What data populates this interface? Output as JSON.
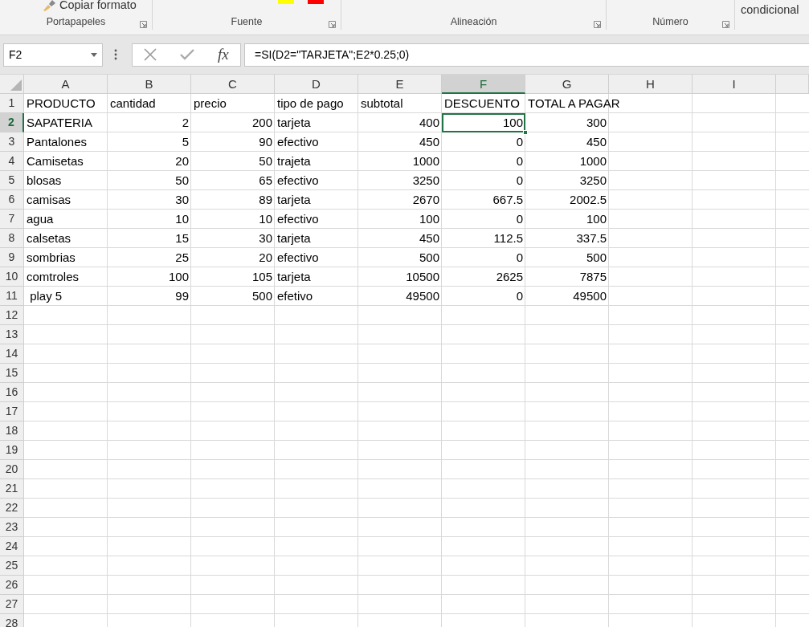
{
  "ribbon": {
    "copy_format": "Copiar formato",
    "groups": [
      {
        "label": "Portapapeles"
      },
      {
        "label": "Fuente"
      },
      {
        "label": "Alineación"
      },
      {
        "label": "Número"
      }
    ],
    "conditional": "condicional"
  },
  "formula_bar": {
    "name_box": "F2",
    "function_label": "fx",
    "formula": "=SI(D2=\"TARJETA\";E2*0.25;0)"
  },
  "columns": [
    {
      "label": "A",
      "selected": false,
      "numeric": false
    },
    {
      "label": "B",
      "selected": false,
      "numeric": true
    },
    {
      "label": "C",
      "selected": false,
      "numeric": true
    },
    {
      "label": "D",
      "selected": false,
      "numeric": false
    },
    {
      "label": "E",
      "selected": false,
      "numeric": true
    },
    {
      "label": "F",
      "selected": true,
      "numeric": true
    },
    {
      "label": "G",
      "selected": false,
      "numeric": true
    },
    {
      "label": "H",
      "selected": false
    },
    {
      "label": "I",
      "selected": false
    }
  ],
  "rows": [
    {
      "number": "1",
      "selected": false,
      "kind": "header",
      "cells": [
        "PRODUCTO",
        "cantidad",
        "precio",
        "tipo de pago",
        "subtotal",
        "DESCUENTO",
        "TOTAL A PAGAR"
      ]
    },
    {
      "number": "2",
      "selected": true,
      "kind": "data",
      "cells": [
        "SAPATERIA",
        "2",
        "200",
        "tarjeta",
        "400",
        "100",
        "300"
      ]
    },
    {
      "number": "3",
      "selected": false,
      "kind": "data",
      "cells": [
        "Pantalones",
        "5",
        "90",
        "efectivo",
        "450",
        "0",
        "450"
      ]
    },
    {
      "number": "4",
      "selected": false,
      "kind": "data",
      "cells": [
        "Camisetas",
        "20",
        "50",
        "trajeta",
        "1000",
        "0",
        "1000"
      ]
    },
    {
      "number": "5",
      "selected": false,
      "kind": "data",
      "cells": [
        "blosas",
        "50",
        "65",
        "efectivo",
        "3250",
        "0",
        "3250"
      ]
    },
    {
      "number": "6",
      "selected": false,
      "kind": "data",
      "cells": [
        "camisas",
        "30",
        "89",
        "tarjeta",
        "2670",
        "667.5",
        "2002.5"
      ]
    },
    {
      "number": "7",
      "selected": false,
      "kind": "data",
      "cells": [
        "agua",
        "10",
        "10",
        "efectivo",
        "100",
        "0",
        "100"
      ]
    },
    {
      "number": "8",
      "selected": false,
      "kind": "data",
      "cells": [
        "calsetas",
        "15",
        "30",
        "tarjeta",
        "450",
        "112.5",
        "337.5"
      ]
    },
    {
      "number": "9",
      "selected": false,
      "kind": "data",
      "cells": [
        "sombrias",
        "25",
        "20",
        "efectivo",
        "500",
        "0",
        "500"
      ]
    },
    {
      "number": "10",
      "selected": false,
      "kind": "data",
      "cells": [
        "comtroles",
        "100",
        "105",
        "tarjeta",
        "10500",
        "2625",
        "7875"
      ]
    },
    {
      "number": "11",
      "selected": false,
      "kind": "data",
      "cells": [
        " play 5",
        "99",
        "500",
        "efetivo",
        "49500",
        "0",
        "49500"
      ]
    },
    {
      "number": "12",
      "selected": false,
      "kind": "data",
      "cells": []
    },
    {
      "number": "13",
      "selected": false,
      "kind": "data",
      "cells": []
    },
    {
      "number": "14",
      "selected": false,
      "kind": "data",
      "cells": []
    },
    {
      "number": "15",
      "selected": false,
      "kind": "data",
      "cells": []
    },
    {
      "number": "16",
      "selected": false,
      "kind": "data",
      "cells": []
    },
    {
      "number": "17",
      "selected": false,
      "kind": "data",
      "cells": []
    },
    {
      "number": "18",
      "selected": false,
      "kind": "data",
      "cells": []
    },
    {
      "number": "19",
      "selected": false,
      "kind": "data",
      "cells": []
    },
    {
      "number": "20",
      "selected": false,
      "kind": "data",
      "cells": []
    },
    {
      "number": "21",
      "selected": false,
      "kind": "data",
      "cells": []
    },
    {
      "number": "22",
      "selected": false,
      "kind": "data",
      "cells": []
    },
    {
      "number": "23",
      "selected": false,
      "kind": "data",
      "cells": []
    },
    {
      "number": "24",
      "selected": false,
      "kind": "data",
      "cells": []
    },
    {
      "number": "25",
      "selected": false,
      "kind": "data",
      "cells": []
    },
    {
      "number": "26",
      "selected": false,
      "kind": "data",
      "cells": []
    },
    {
      "number": "27",
      "selected": false,
      "kind": "data",
      "cells": []
    },
    {
      "number": "28",
      "selected": false,
      "kind": "data",
      "cells": []
    }
  ]
}
